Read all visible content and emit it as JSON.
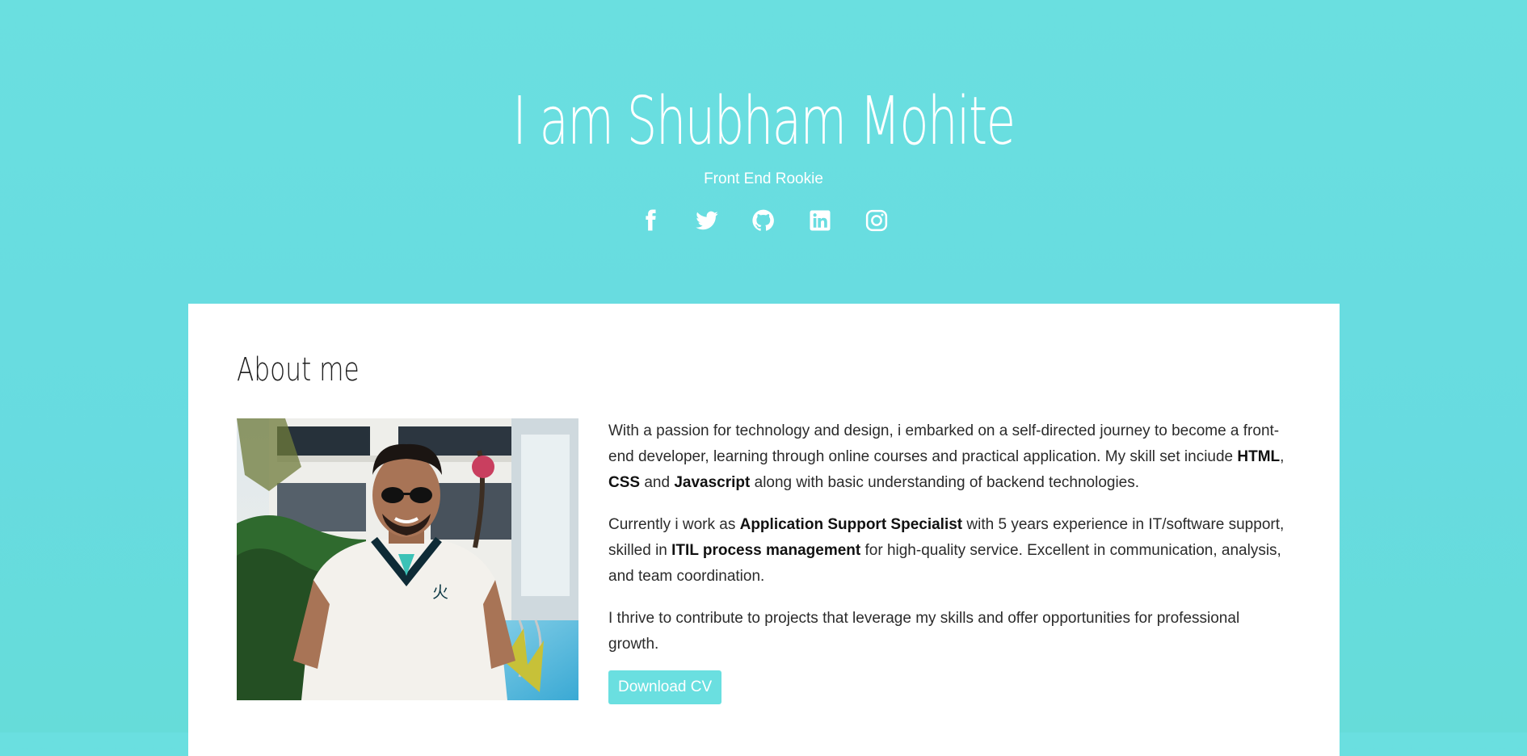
{
  "hero": {
    "title": "I am Shubham Mohite",
    "subtitle": "Front End Rookie",
    "social": [
      {
        "name": "facebook-icon"
      },
      {
        "name": "twitter-icon"
      },
      {
        "name": "github-icon"
      },
      {
        "name": "linkedin-icon"
      },
      {
        "name": "instagram-icon"
      }
    ]
  },
  "about": {
    "title": "About me",
    "p1": {
      "a": "With a passion for technology and design, i embarked on a self-directed journey to become a front-end developer, learning through online courses and practical application. My skill set inciude ",
      "html": "HTML",
      "sep1": ", ",
      "css": "CSS",
      "sep2": " and ",
      "js": "Javascript",
      "b": " along with basic understanding of backend technologies."
    },
    "p2": {
      "a": "Currently i work as ",
      "role": "Application Support Specialist",
      "b": " with 5 years experience in IT/software support, skilled in ",
      "itil": "ITIL process management",
      "c": " for high-quality service. Excellent in communication, analysis, and team coordination."
    },
    "p3": "I thrive to contribute to projects that leverage my skills and offer opportunities for professional growth.",
    "download_label": "Download CV"
  },
  "colors": {
    "accent": "#6adfe0",
    "background": "#67dbe0",
    "card": "#ffffff"
  }
}
